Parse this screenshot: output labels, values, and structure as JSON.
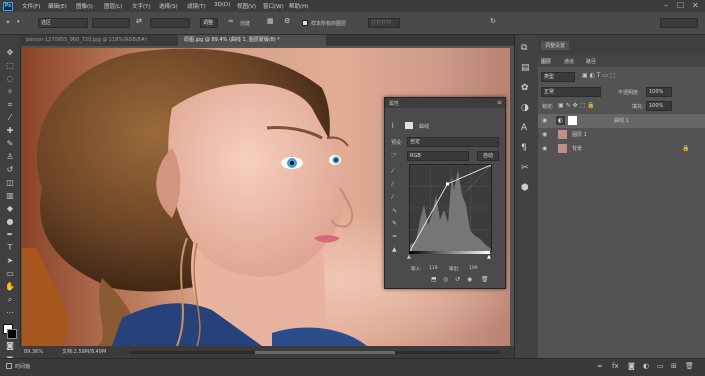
{
  "app": {
    "logo": "Ps"
  },
  "menu": [
    "文件(F)",
    "编辑(E)",
    "图像(I)",
    "图层(L)",
    "文字(Y)",
    "选择(S)",
    "滤镜(T)",
    "3D(D)",
    "视图(V)",
    "窗口(W)",
    "帮助(H)"
  ],
  "window_controls": {
    "minimize": "–",
    "maximize": "☐",
    "close": "✕"
  },
  "options": {
    "mode_value": "选区",
    "size_field": "",
    "mode_label": "调整",
    "select_label": "创建",
    "sample_all": "样本所有的图层",
    "right_field": "打开打印"
  },
  "tabs": {
    "tab1": "person-1270955_960_720.jpg @ 118%(RGB/8#)",
    "tab2": "原图.jpg @ 89.4% (曲线 1, 图层蒙版/8) *"
  },
  "status": {
    "zoom": "89.36%",
    "doc": "文档:2.59M/8.49M"
  },
  "bottom": {
    "timeline": "时间轴"
  },
  "right_panel": {
    "tabs": [
      "调整设置"
    ],
    "layer_tabs": [
      "图层",
      "通道",
      "路径"
    ],
    "kind_label": "类型",
    "blend_mode": "正常",
    "opacity_label": "不透明度:",
    "opacity": "100%",
    "lock_label": "锁定:",
    "fill_label": "填充:",
    "fill": "100%",
    "layers": [
      {
        "name": "曲线 1"
      },
      {
        "name": "图层 1"
      },
      {
        "name": "背景"
      }
    ]
  },
  "properties": {
    "title": "属性",
    "layer_name": "曲线",
    "preset_label": "预设:",
    "preset_value": "自定",
    "channel": "RGB",
    "auto_button": "自动",
    "input_label": "输入:",
    "input_value": "118",
    "output_label": "输出:",
    "output_value": "199"
  },
  "curve": {
    "points": [
      [
        0,
        0
      ],
      [
        118,
        199
      ],
      [
        255,
        255
      ]
    ]
  },
  "colors": {
    "accent": "#31a8ff",
    "panel_bg": "#535353",
    "dark_bg": "#3c3c3c",
    "shirt": "#27417a"
  }
}
